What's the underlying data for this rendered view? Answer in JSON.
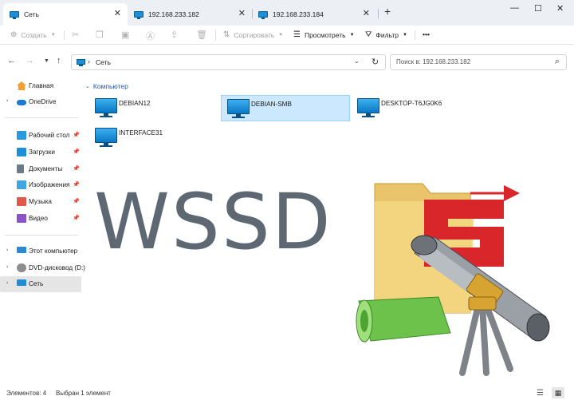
{
  "tabs": [
    {
      "label": "Сеть"
    },
    {
      "label": "192.168.233.182"
    },
    {
      "label": "192.168.233.184"
    }
  ],
  "toolbar": {
    "create_label": "Создать",
    "sort_label": "Сортировать",
    "view_label": "Просмотреть",
    "filter_label": "Фильтр",
    "more_label": "•••"
  },
  "address": {
    "path": "Сеть",
    "search_placeholder": "Поиск в: 192.168.233.182"
  },
  "sidebar": {
    "items": [
      {
        "label": "Главная"
      },
      {
        "label": "OneDrive"
      },
      {
        "label": "Рабочий стол"
      },
      {
        "label": "Загрузки"
      },
      {
        "label": "Документы"
      },
      {
        "label": "Изображения"
      },
      {
        "label": "Музыка"
      },
      {
        "label": "Видео"
      },
      {
        "label": "Этот компьютер"
      },
      {
        "label": "DVD-дисковод (D:)"
      },
      {
        "label": "Сеть"
      }
    ]
  },
  "main": {
    "section_title": "Компьютер",
    "computers": [
      {
        "name": "DEBIAN12"
      },
      {
        "name": "DEBIAN-SMB",
        "selected": true
      },
      {
        "name": "DESKTOP-T6JG0K6"
      },
      {
        "name": "INTERFACE31"
      }
    ]
  },
  "overlay": {
    "wordmark": "WSSD",
    "logo_icon": "telescope-s-logo"
  },
  "status": {
    "items_count": "Элементов: 4",
    "selected_count": "Выбран 1 элемент"
  },
  "colors": {
    "accent": "#1e5aa8",
    "selection": "#cce8ff",
    "wordmark": "#5d6873"
  }
}
